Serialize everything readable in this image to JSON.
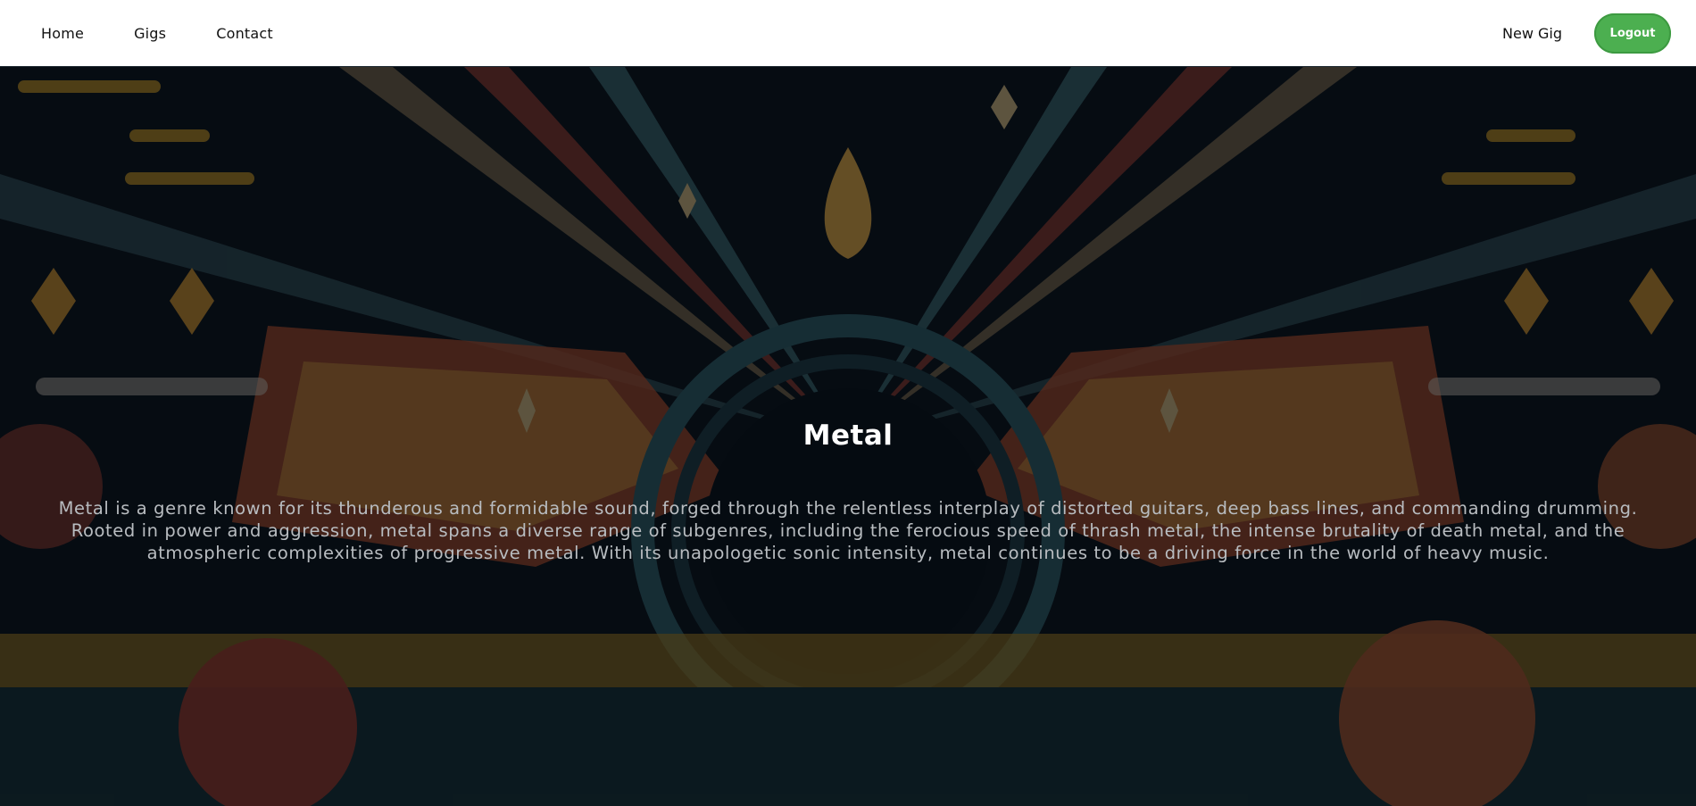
{
  "nav": {
    "links": [
      {
        "label": "Home"
      },
      {
        "label": "Gigs"
      },
      {
        "label": "Contact"
      }
    ],
    "new_gig_label": "New Gig",
    "logout_label": "Logout"
  },
  "hero": {
    "title": "Metal",
    "description": "Metal is a genre known for its thunderous and formidable sound, forged through the relentless interplay of distorted guitars, deep bass lines, and commanding drumming. Rooted in power and aggression, metal spans a diverse range of subgenres, including the ferocious speed of thrash metal, the intense brutality of death metal, and the atmospheric complexities of progressive metal. With its unapologetic sonic intensity, metal continues to be a driving force in the world of heavy music."
  },
  "colors": {
    "accent": "#4caf50",
    "background": "#05080d",
    "nav_background": "#ffffff"
  }
}
